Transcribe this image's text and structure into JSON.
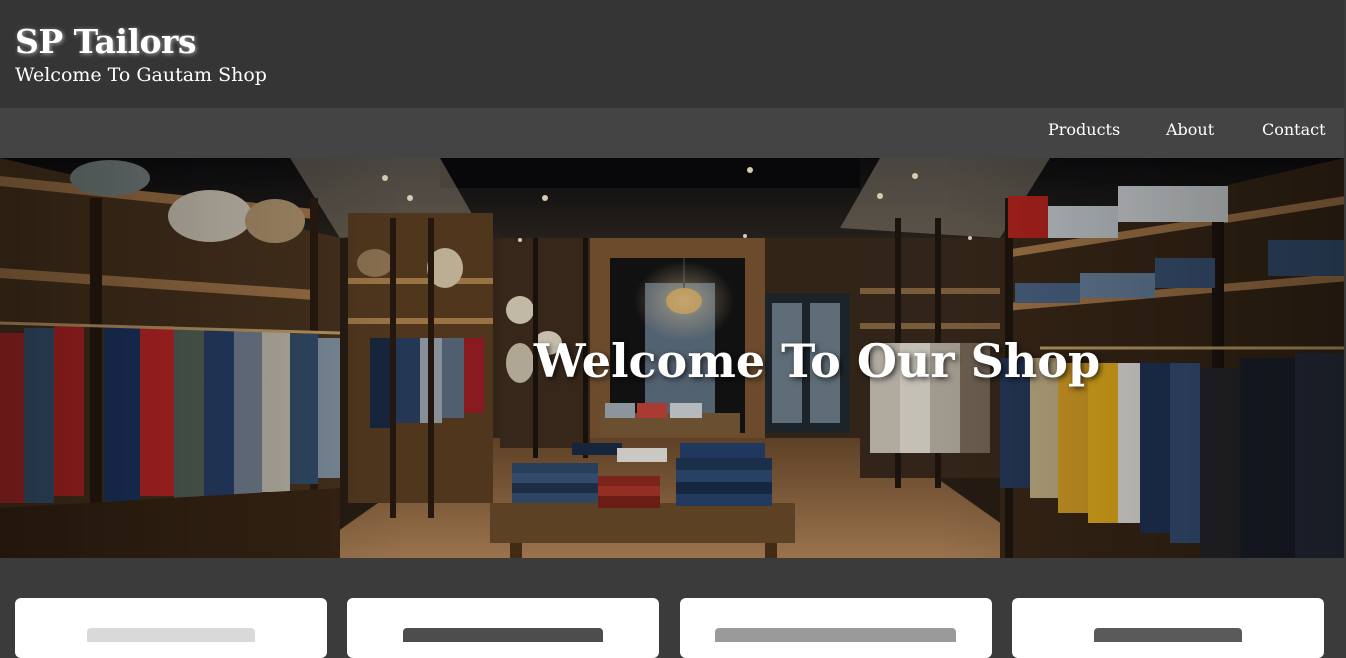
{
  "header": {
    "title": "SP Tailors",
    "subtitle": "Welcome To Gautam Shop"
  },
  "nav": {
    "items": [
      {
        "label": "Products"
      },
      {
        "label": "About"
      },
      {
        "label": "Contact"
      }
    ]
  },
  "hero": {
    "heading": "Welcome To Our Shop",
    "image": "clothing-store-interior"
  },
  "products": {
    "cards": [
      {
        "image": "product-image-1"
      },
      {
        "image": "product-image-2"
      },
      {
        "image": "product-image-3"
      },
      {
        "image": "product-image-4"
      }
    ]
  },
  "colors": {
    "header_bg": "#353535",
    "nav_bg": "#444444",
    "page_bg": "#3b3b3b",
    "card_bg": "#ffffff",
    "text": "#ffffff"
  }
}
